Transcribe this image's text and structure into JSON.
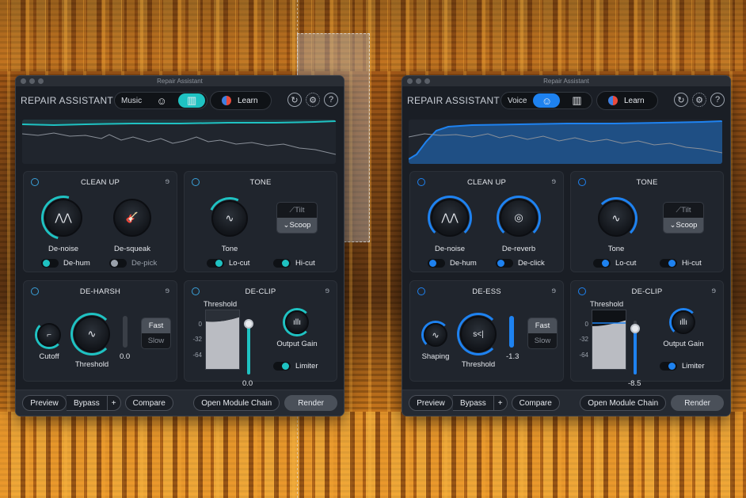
{
  "app": {
    "window_title": "Repair Assistant",
    "brand": "REPAIR ASSISTANT",
    "learn_label": "Learn",
    "help_label": "?"
  },
  "colors": {
    "music_accent": "#1fc2c2",
    "voice_accent": "#1e82f0"
  },
  "left": {
    "mode_label": "Music",
    "cleanup": {
      "title": "CLEAN UP",
      "knob1": "De-noise",
      "knob2": "De-squeak",
      "tog1": "De-hum",
      "tog2": "De-pick"
    },
    "tone": {
      "title": "TONE",
      "knob": "Tone",
      "tilt": "Tilt",
      "scoop": "Scoop",
      "tog1": "Lo-cut",
      "tog2": "Hi-cut"
    },
    "deharsh": {
      "title": "DE-HARSH",
      "knob_small": "Cutoff",
      "knob_big": "Threshold",
      "fast": "Fast",
      "slow": "Slow",
      "value": "0.0"
    },
    "declip": {
      "title": "DE-CLIP",
      "threshold_label": "Threshold",
      "y0": "0",
      "y1": "-32",
      "y2": "-64",
      "value": "0.0",
      "output_gain": "Output Gain",
      "limiter": "Limiter"
    }
  },
  "right": {
    "mode_label": "Voice",
    "cleanup": {
      "title": "CLEAN UP",
      "knob1": "De-noise",
      "knob2": "De-reverb",
      "tog1": "De-hum",
      "tog2": "De-click"
    },
    "tone": {
      "title": "TONE",
      "knob": "Tone",
      "tilt": "Tilt",
      "scoop": "Scoop",
      "tog1": "Lo-cut",
      "tog2": "Hi-cut"
    },
    "deess": {
      "title": "DE-ESS",
      "knob_small": "Shaping",
      "knob_big": "Threshold",
      "fast": "Fast",
      "slow": "Slow",
      "value": "-1.3"
    },
    "declip": {
      "title": "DE-CLIP",
      "threshold_label": "Threshold",
      "y0": "0",
      "y1": "-32",
      "y2": "-64",
      "value": "-8.5",
      "output_gain": "Output Gain",
      "limiter": "Limiter"
    }
  },
  "footer": {
    "preview": "Preview",
    "bypass": "Bypass",
    "plus": "+",
    "compare": "Compare",
    "open_chain": "Open Module Chain",
    "render": "Render"
  }
}
